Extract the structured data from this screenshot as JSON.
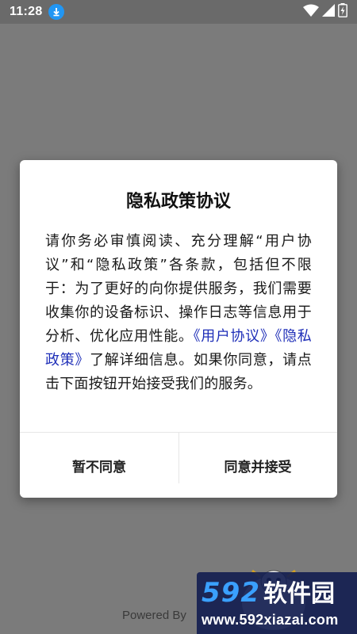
{
  "status_bar": {
    "time": "11:28",
    "icons": [
      "download-icon",
      "wifi-icon",
      "signal-icon",
      "battery-charging-icon"
    ]
  },
  "dialog": {
    "title": "隐私政策协议",
    "body_prefix": "请你务必审慎阅读、充分理解“用户协议”和“隐私政策”各条款，包括但不限于：为了更好的向你提供服务，我们需要收集你的设备标识、操作日志等信息用于分析、优化应用性能。",
    "link_user_agreement": "《用户协议》",
    "link_privacy_policy": "《隐私政策》",
    "body_suffix": "了解详细信息。如果你同意，请点击下面按钮开始接受我们的服务。",
    "decline_label": "暂不同意",
    "accept_label": "同意并接受"
  },
  "background": {
    "powered_by": "Powered By"
  },
  "watermark": {
    "number": "592",
    "name": "软件园",
    "url": "www.592xiazai.com"
  },
  "colors": {
    "overlay": "#7b7b7b",
    "link": "#1f2fb8",
    "download_icon": "#2196f3",
    "watermark_bg": "#141e50",
    "watermark_number": "#3aa0ff"
  }
}
